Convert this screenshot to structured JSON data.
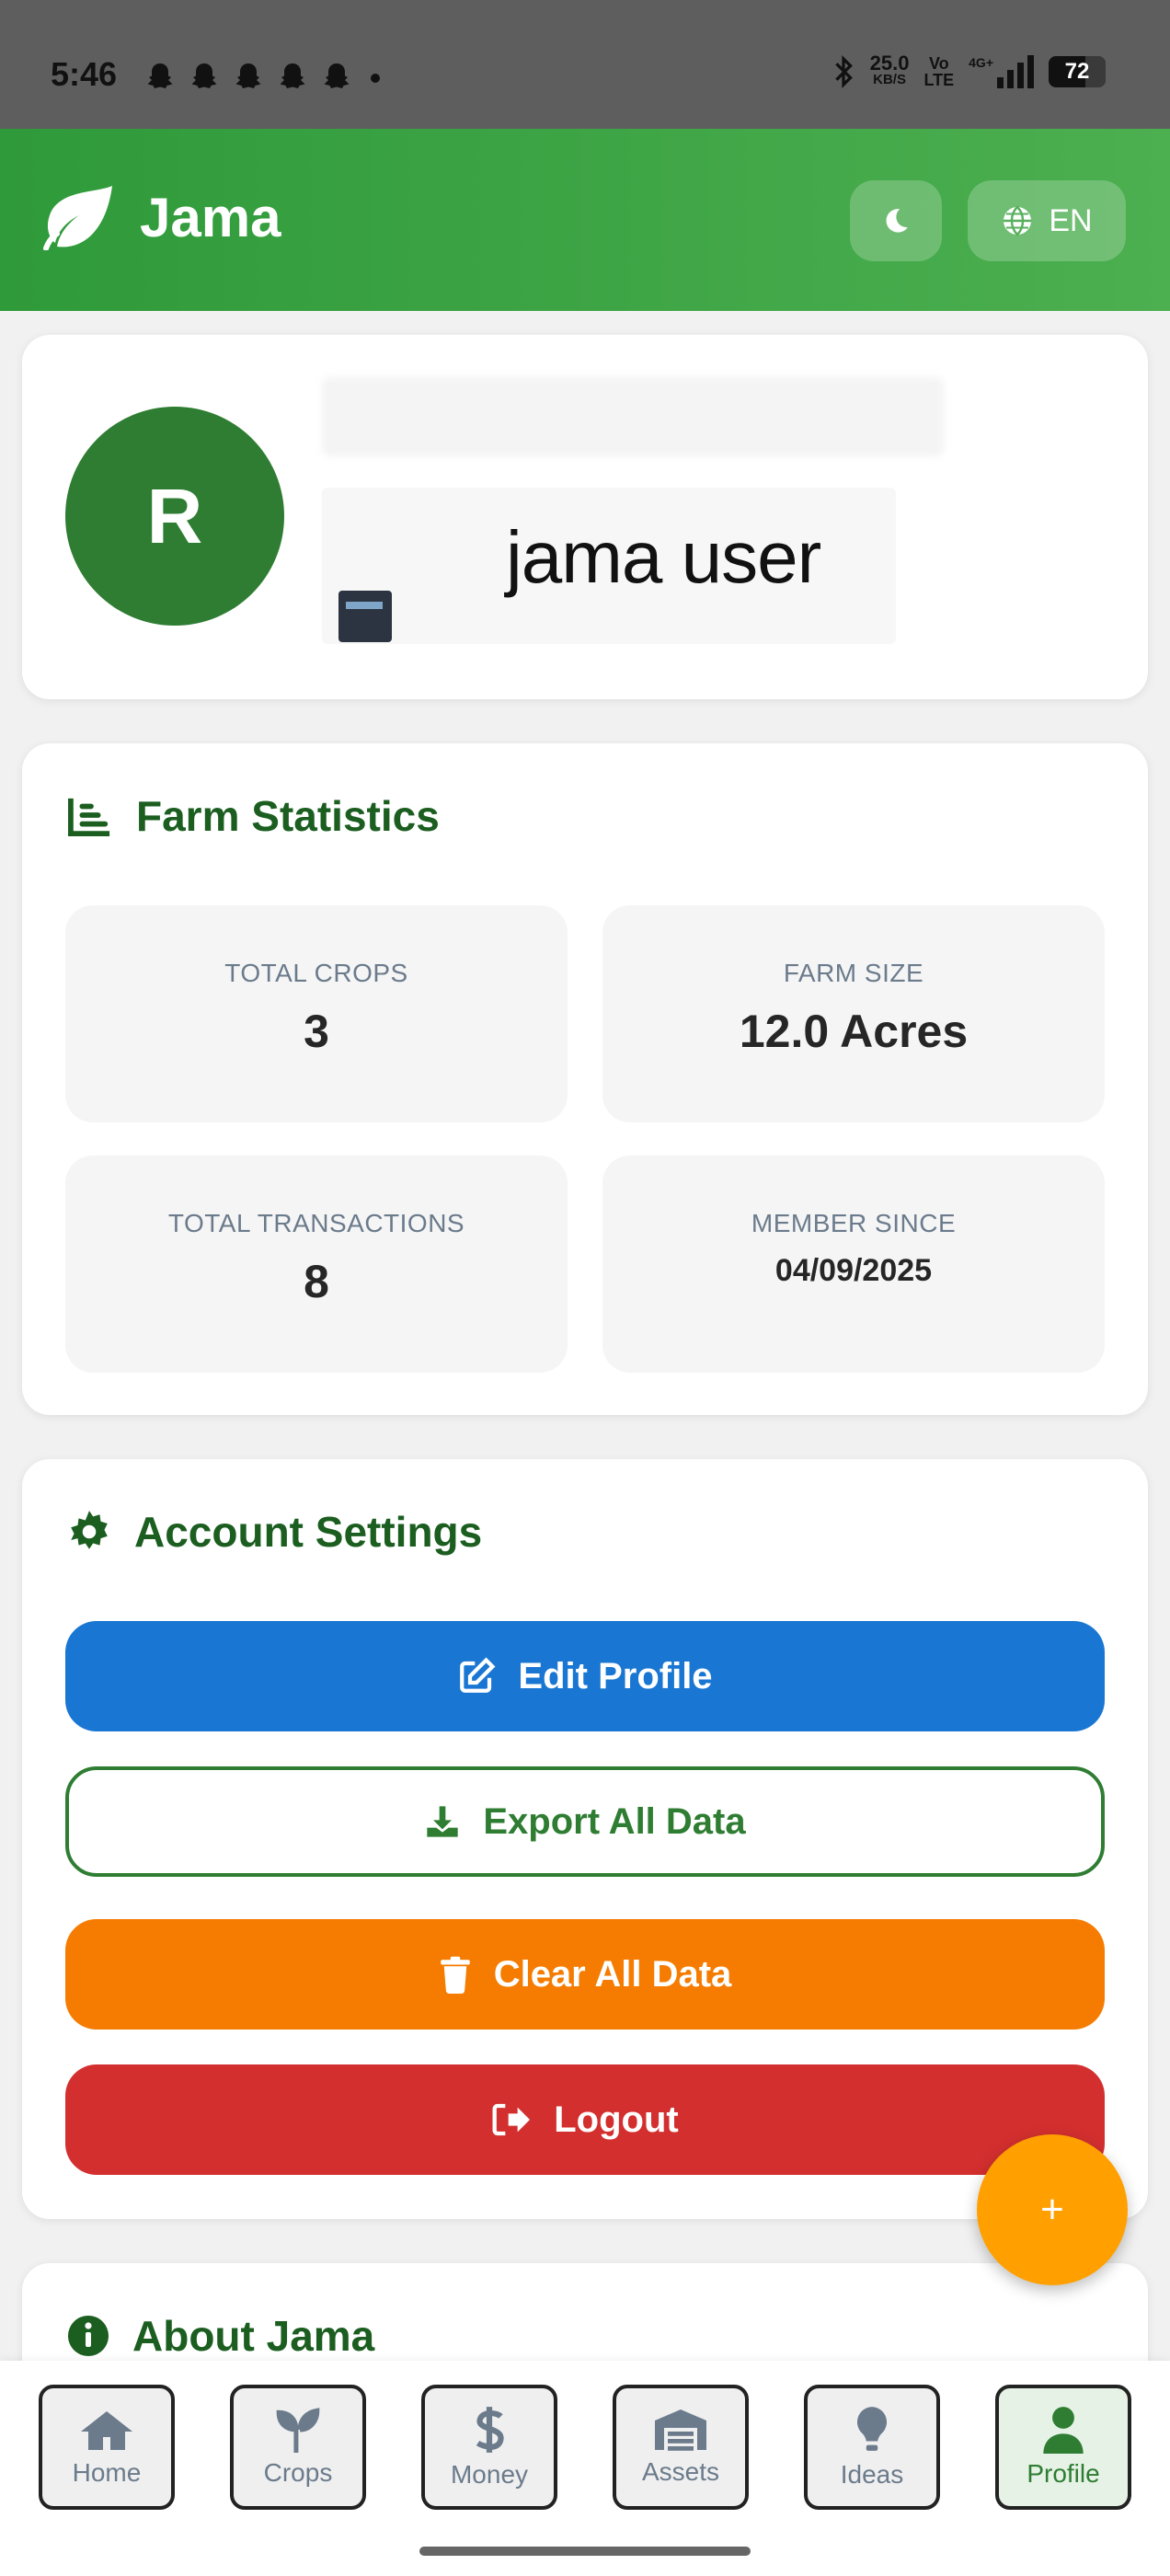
{
  "status_bar": {
    "time": "5:46",
    "net_speed": "25.0",
    "net_unit": "KB/S",
    "volte_top": "Vo",
    "volte_bottom": "LTE",
    "signal": "4G+",
    "battery": "72"
  },
  "header": {
    "app_name": "Jama",
    "language": "EN",
    "brand_color": "#2f9a3a"
  },
  "profile": {
    "avatar_initial": "R",
    "user_name": "jama user"
  },
  "farm_statistics": {
    "title": "Farm Statistics",
    "stats": [
      {
        "label": "TOTAL CROPS",
        "value": "3"
      },
      {
        "label": "FARM SIZE",
        "value": "12.0 Acres"
      },
      {
        "label": "TOTAL TRANSACTIONS",
        "value": "8"
      },
      {
        "label": "MEMBER SINCE",
        "value": "04/09/2025"
      }
    ]
  },
  "account_settings": {
    "title": "Account Settings",
    "edit_profile": "Edit Profile",
    "export_data": "Export All Data",
    "clear_data": "Clear All Data",
    "logout": "Logout"
  },
  "about": {
    "title": "About Jama"
  },
  "fab": {
    "label": "+"
  },
  "nav": {
    "items": [
      {
        "label": "Home",
        "icon": "home-icon"
      },
      {
        "label": "Crops",
        "icon": "seedling-icon"
      },
      {
        "label": "Money",
        "icon": "dollar-icon"
      },
      {
        "label": "Assets",
        "icon": "warehouse-icon"
      },
      {
        "label": "Ideas",
        "icon": "lightbulb-icon"
      },
      {
        "label": "Profile",
        "icon": "user-icon"
      }
    ],
    "active": "Profile"
  }
}
